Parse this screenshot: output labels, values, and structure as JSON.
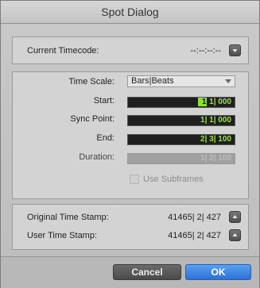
{
  "window": {
    "title": "Spot Dialog"
  },
  "timecode": {
    "label": "Current Timecode:",
    "value": "--:--:--:--"
  },
  "time_scale": {
    "label": "Time Scale:",
    "selected": "Bars|Beats"
  },
  "fields": {
    "start": {
      "label": "Start:",
      "value_main": "1",
      "value_rest": " 1| 000"
    },
    "sync_point": {
      "label": "Sync Point:",
      "value": "1| 1| 000"
    },
    "end": {
      "label": "End:",
      "value": "2| 3| 100"
    },
    "duration": {
      "label": "Duration:",
      "value": "1| 2| 100"
    }
  },
  "subframes": {
    "label": "Use Subframes",
    "checked": false
  },
  "stamps": {
    "original": {
      "label": "Original Time Stamp:",
      "value": "41465| 2| 427"
    },
    "user": {
      "label": "User Time Stamp:",
      "value": "41465| 2| 427"
    }
  },
  "buttons": {
    "cancel": "Cancel",
    "ok": "OK"
  },
  "icons": {
    "up_arrow": "up-arrow-icon",
    "down_arrow": "down-arrow-icon"
  },
  "colors": {
    "counter_text": "#9de24f",
    "highlight": "#8de22e",
    "ok_button": "#3a82e0"
  }
}
